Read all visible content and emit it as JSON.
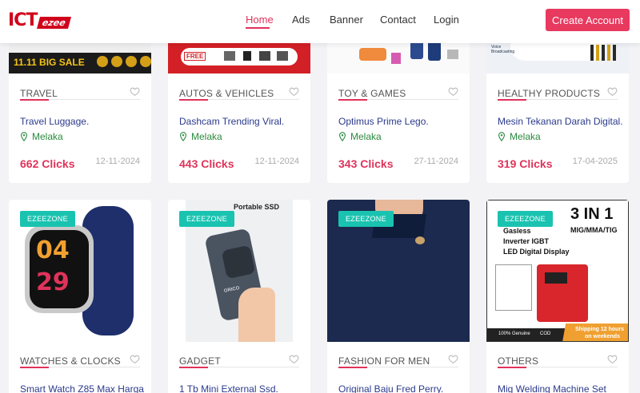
{
  "brand": {
    "logo_main": "ICT",
    "logo_sub": "ezee"
  },
  "nav": {
    "items": [
      "Home",
      "Ads",
      "Banner",
      "Contact",
      "Login"
    ],
    "active": "Home"
  },
  "header": {
    "create_account": "Create Account"
  },
  "top_row": [
    {
      "category": "TRAVEL",
      "title": "Travel Luggage.",
      "location": "Melaka",
      "clicks": "662 Clicks",
      "date": "12-11-2024",
      "banner_text": "11.11 BIG SALE"
    },
    {
      "category": "AUTOS & VEHICLES",
      "title": "Dashcam Trending Viral.",
      "location": "Melaka",
      "clicks": "443 Clicks",
      "date": "12-11-2024",
      "banner_text": "FREE"
    },
    {
      "category": "TOY & GAMES",
      "title": "Optimus Prime Lego.",
      "location": "Melaka",
      "clicks": "343 Clicks",
      "date": "27-11-2024"
    },
    {
      "category": "HEALTHY PRODUCTS",
      "title": "Mesin Tekanan Darah Digital.",
      "location": "Melaka",
      "clicks": "319 Clicks",
      "date": "17-04-2025",
      "banner_text": "Voice Broadcasting"
    }
  ],
  "bottom_row": [
    {
      "badge": "EZEEZONE",
      "category": "WATCHES & CLOCKS",
      "title": "Smart Watch Z85 Max Harga",
      "watch_digits": [
        "04",
        "29"
      ]
    },
    {
      "badge": "EZEEZONE",
      "category": "GADGET",
      "title": "1 Tb Mini External Ssd.",
      "image_heading": "Portable SSD",
      "image_brand": "ORICO"
    },
    {
      "badge": "EZEEZONE",
      "category": "FASHION FOR MEN",
      "title": "Original Baju Fred Perry."
    },
    {
      "badge": "EZEEZONE",
      "category": "OTHERS",
      "title": "Mig Welding Machine Set",
      "image_heading": "3 IN 1",
      "image_sub": "MIG/MMA/TIG",
      "image_features": [
        "Gasless",
        "Inverter IGBT",
        "LED Digital Display"
      ],
      "image_footer": [
        "100% Genuine",
        "COD"
      ],
      "shipping": [
        "Shipping 12 hours",
        "on weekends"
      ]
    }
  ],
  "colors": {
    "accent": "#e0335a",
    "badge": "#19c3b0",
    "title": "#2b3a8c",
    "location": "#2b8a3e"
  }
}
